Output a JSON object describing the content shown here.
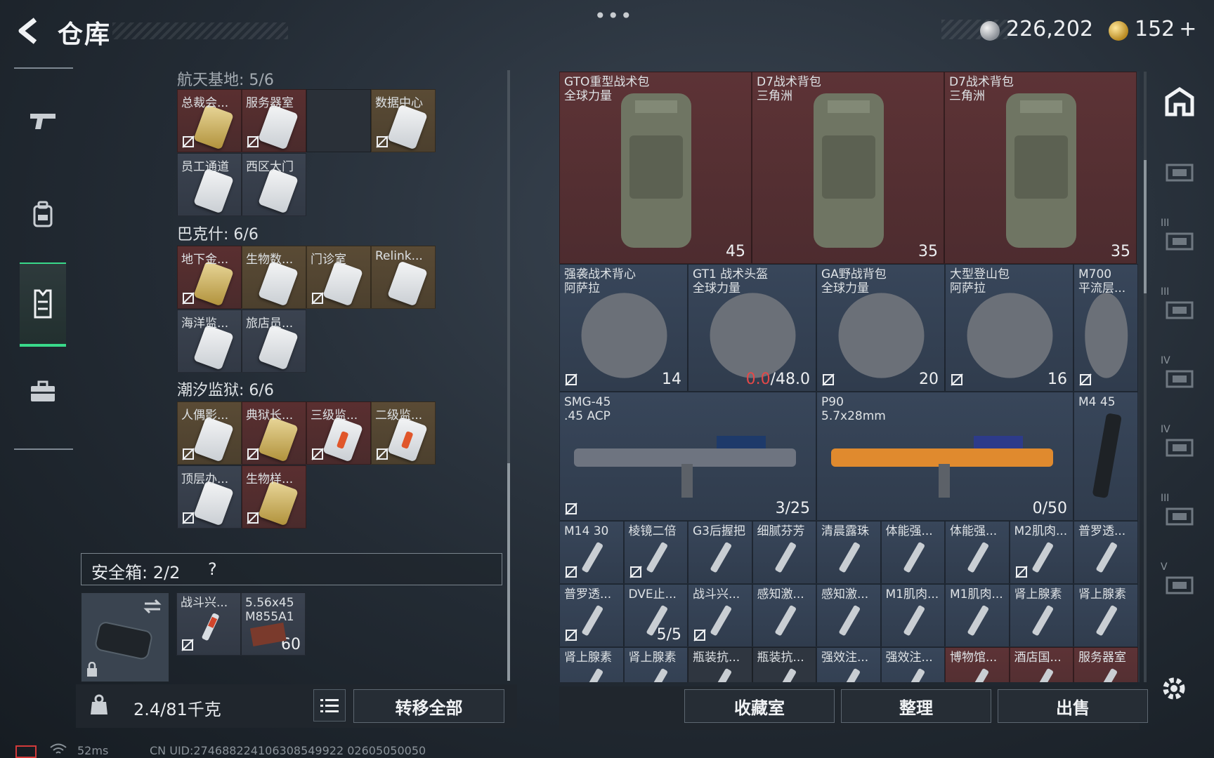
{
  "header": {
    "title": "仓库",
    "silver_amount": "226,202",
    "gold_amount": "152",
    "gold_plus": "+"
  },
  "left_nav": {
    "items": [
      {
        "icon": "pistol-icon"
      },
      {
        "icon": "backpack-icon"
      },
      {
        "icon": "vest-icon",
        "active": true
      },
      {
        "icon": "briefcase-icon"
      }
    ]
  },
  "storage": {
    "partial_section_title": "航天基地: 5/6",
    "sections": [
      {
        "title": "",
        "cells": [
          {
            "label": "总裁会...",
            "color": "red",
            "card": "gold",
            "lock": true
          },
          {
            "label": "服务器室",
            "color": "red",
            "card": "white",
            "lock": true
          },
          {
            "label": "",
            "color": "empty",
            "card": "",
            "lock": false
          },
          {
            "label": "数据中心",
            "color": "gold",
            "card": "white",
            "lock": true
          },
          {
            "label": "员工通道",
            "color": "gray",
            "card": "white",
            "lock": false
          },
          {
            "label": "西区大门",
            "color": "gray",
            "card": "white",
            "lock": false
          }
        ]
      },
      {
        "title": "巴克什: 6/6",
        "cells": [
          {
            "label": "地下金...",
            "color": "red",
            "card": "gold",
            "lock": true
          },
          {
            "label": "生物数...",
            "color": "gold",
            "card": "white",
            "lock": false
          },
          {
            "label": "门诊室",
            "color": "gold",
            "card": "white",
            "lock": true
          },
          {
            "label": "Relink...",
            "color": "gold",
            "card": "white",
            "lock": false
          },
          {
            "label": "海洋监...",
            "color": "gray",
            "card": "white",
            "lock": false
          },
          {
            "label": "旅店员...",
            "color": "gray",
            "card": "white",
            "lock": false
          }
        ]
      },
      {
        "title": "潮汐监狱: 6/6",
        "cells": [
          {
            "label": "人偶影...",
            "color": "gold",
            "card": "white",
            "lock": true
          },
          {
            "label": "典狱长...",
            "color": "red",
            "card": "gold",
            "lock": true
          },
          {
            "label": "三级监...",
            "color": "red",
            "card": "red",
            "lock": true
          },
          {
            "label": "二级监...",
            "color": "gold",
            "card": "red",
            "lock": true
          },
          {
            "label": "顶层办...",
            "color": "gray",
            "card": "white",
            "lock": true
          },
          {
            "label": "生物样...",
            "color": "red",
            "card": "gold",
            "lock": true
          }
        ]
      }
    ],
    "safebox": {
      "title": "安全箱: 2/2",
      "help": "?",
      "items": [
        {
          "label": "战斗兴...",
          "count": ""
        },
        {
          "label": "5.56x45\nM855A1",
          "count": "60"
        }
      ]
    },
    "weight": "2.4/81千克",
    "transfer_all_label": "转移全部"
  },
  "inventory": {
    "rows": [
      [
        {
          "label": "GTO重型战术包\n全球力量",
          "count": "45",
          "color": "red",
          "w": 3
        },
        {
          "label": "D7战术背包\n三角洲",
          "count": "35",
          "color": "red",
          "w": 3
        },
        {
          "label": "D7战术背包\n三角洲",
          "count": "35",
          "color": "red",
          "w": 3
        }
      ],
      [
        {
          "label": "强袭战术背心\n阿萨拉",
          "count": "14",
          "color": "blue",
          "w": 2
        },
        {
          "label": "GT1 战术头盔\n全球力量",
          "count_warn": "0.0",
          "count": "/48.0",
          "color": "blue",
          "w": 2
        },
        {
          "label": "GA野战背包\n全球力量",
          "count": "20",
          "color": "blue",
          "w": 2
        },
        {
          "label": "大型登山包\n阿萨拉",
          "count": "16",
          "color": "blue",
          "w": 2
        },
        {
          "label": "M700\n平流层...",
          "count": "",
          "color": "blue",
          "w": 1
        }
      ],
      [
        {
          "label": "SMG-45\n.45 ACP",
          "count": "3/25",
          "color": "blue",
          "w": 4
        },
        {
          "label": "P90\n5.7x28mm",
          "count": "0/50",
          "color": "blue",
          "w": 4
        },
        {
          "label": "M4 45",
          "count": "",
          "color": "blue",
          "w": 1
        }
      ],
      [
        {
          "label": "M14 30",
          "count": "",
          "color": "blue",
          "w": 1
        },
        {
          "label": "棱镜二倍",
          "count": "",
          "color": "blue",
          "w": 1
        },
        {
          "label": "G3后握把",
          "count": "",
          "color": "blue",
          "w": 1
        },
        {
          "label": "细腻芬芳",
          "count": "",
          "color": "blue",
          "w": 1
        },
        {
          "label": "清晨露珠",
          "count": "",
          "color": "blue",
          "w": 1
        },
        {
          "label": "体能强...",
          "count": "",
          "color": "blue",
          "w": 1
        },
        {
          "label": "体能强...",
          "count": "",
          "color": "blue",
          "w": 1
        },
        {
          "label": "M2肌肉...",
          "count": "",
          "color": "blue",
          "w": 1
        },
        {
          "label": "普罗透...",
          "count": "",
          "color": "blue",
          "w": 1
        }
      ],
      [
        {
          "label": "普罗透...",
          "count": "",
          "color": "blue",
          "w": 1
        },
        {
          "label": "DVE止...",
          "count": "5/5",
          "color": "blue",
          "w": 1
        },
        {
          "label": "战斗兴...",
          "count": "",
          "color": "blue",
          "w": 1
        },
        {
          "label": "感知激...",
          "count": "",
          "color": "blue",
          "w": 1
        },
        {
          "label": "感知激...",
          "count": "",
          "color": "blue",
          "w": 1
        },
        {
          "label": "M1肌肉...",
          "count": "",
          "color": "blue",
          "w": 1
        },
        {
          "label": "M1肌肉...",
          "count": "",
          "color": "blue",
          "w": 1
        },
        {
          "label": "肾上腺素",
          "count": "",
          "color": "blue",
          "w": 1
        },
        {
          "label": "肾上腺素",
          "count": "",
          "color": "blue",
          "w": 1
        }
      ],
      [
        {
          "label": "肾上腺素",
          "count": "",
          "color": "blue",
          "w": 1
        },
        {
          "label": "肾上腺素",
          "count": "",
          "color": "blue",
          "w": 1
        },
        {
          "label": "瓶装抗...",
          "count": "",
          "color": "dark",
          "w": 1
        },
        {
          "label": "瓶装抗...",
          "count": "",
          "color": "dark",
          "w": 1
        },
        {
          "label": "强效注...",
          "count": "",
          "color": "blue",
          "w": 1
        },
        {
          "label": "强效注...",
          "count": "",
          "color": "blue",
          "w": 1
        },
        {
          "label": "博物馆...",
          "count": "",
          "color": "red",
          "w": 1
        },
        {
          "label": "酒店国...",
          "count": "",
          "color": "red",
          "w": 1
        },
        {
          "label": "服务器室",
          "count": "",
          "color": "red",
          "w": 1
        }
      ]
    ],
    "buttons": {
      "collection": "收藏室",
      "sort": "整理",
      "sell": "出售"
    }
  },
  "right_nav": {
    "items": [
      "home-icon",
      "tier-ii-icon",
      "tier-iii-icon",
      "tier-iii-icon",
      "tier-iv-icon",
      "tier-iv-icon",
      "tier-iii-icon",
      "tier-v-icon"
    ],
    "tier_labels": [
      "",
      "",
      "III",
      "III",
      "IV",
      "IV",
      "III",
      "V"
    ]
  },
  "status": {
    "ping": "52ms",
    "uid": "CN UID:274688224106308549922 02605050050"
  }
}
